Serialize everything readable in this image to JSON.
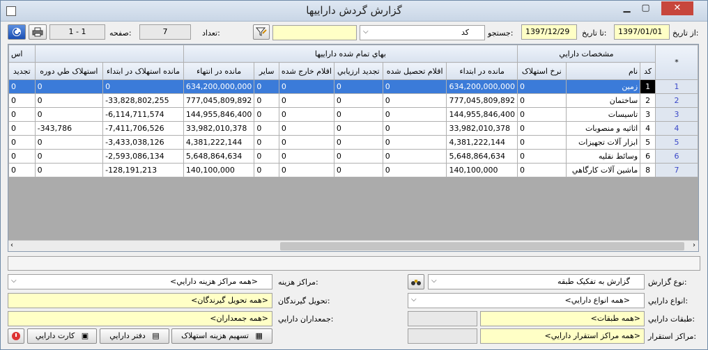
{
  "window": {
    "title": "گزارش گردش داراییها"
  },
  "toolbar": {
    "from_date_label": "از تاریخ:",
    "from_date": "1397/01/01",
    "to_date_label": "تا تاریخ:",
    "to_date": "1397/12/29",
    "search_label": "جستجو:",
    "search_field": "کد",
    "search_value": "",
    "count_label": "تعداد:",
    "count_value": "7",
    "page_label": "صفحه:",
    "page_value": "1 - 1"
  },
  "grid": {
    "groups": {
      "asset_specs": "مشخصات دارايي",
      "total_cost": "بهاي تمام شده داراییها",
      "partial": "اس"
    },
    "columns": {
      "star": "*",
      "code": "کد",
      "name": "نام",
      "dep_rate": "نرخ استهلاک",
      "opening_balance": "مانده در ابتداء",
      "additions": "اقلام تحصيل شده",
      "revaluation": "تجديد ارزيابي",
      "disposals": "اقلام خارج شده",
      "other": "ساير",
      "closing_balance": "مانده در انتهاء",
      "opening_accum_dep": "مانده استهلاک در ابتداء",
      "period_dep": "استهلاک طي دوره",
      "renew": "تجديد"
    },
    "rows": [
      {
        "rn": "1",
        "code": "1",
        "name": "زمين",
        "dep_rate": "0",
        "opening_balance": "634,200,000,000",
        "additions": "0",
        "revaluation": "0",
        "disposals": "0",
        "other": "0",
        "closing_balance": "634,200,000,000",
        "opening_accum_dep": "0",
        "period_dep": "0",
        "renew": "0"
      },
      {
        "rn": "2",
        "code": "2",
        "name": "ساختمان",
        "dep_rate": "0",
        "opening_balance": "777,045,809,892",
        "additions": "0",
        "revaluation": "0",
        "disposals": "0",
        "other": "0",
        "closing_balance": "777,045,809,892",
        "opening_accum_dep": "-33,828,802,255",
        "period_dep": "0",
        "renew": "0"
      },
      {
        "rn": "3",
        "code": "3",
        "name": "تاسيسات",
        "dep_rate": "0",
        "opening_balance": "144,955,846,400",
        "additions": "0",
        "revaluation": "0",
        "disposals": "0",
        "other": "0",
        "closing_balance": "144,955,846,400",
        "opening_accum_dep": "-6,114,711,574",
        "period_dep": "0",
        "renew": "0"
      },
      {
        "rn": "4",
        "code": "4",
        "name": "اثاثيه و منصوبات",
        "dep_rate": "0",
        "opening_balance": "33,982,010,378",
        "additions": "0",
        "revaluation": "0",
        "disposals": "0",
        "other": "0",
        "closing_balance": "33,982,010,378",
        "opening_accum_dep": "-7,411,706,526",
        "period_dep": "-343,786",
        "renew": "0"
      },
      {
        "rn": "5",
        "code": "5",
        "name": "ابزار آلات تجهيزات",
        "dep_rate": "0",
        "opening_balance": "4,381,222,144",
        "additions": "0",
        "revaluation": "0",
        "disposals": "0",
        "other": "0",
        "closing_balance": "4,381,222,144",
        "opening_accum_dep": "-3,433,038,126",
        "period_dep": "0",
        "renew": "0"
      },
      {
        "rn": "6",
        "code": "6",
        "name": "وسائط نقليه",
        "dep_rate": "0",
        "opening_balance": "5,648,864,634",
        "additions": "0",
        "revaluation": "0",
        "disposals": "0",
        "other": "0",
        "closing_balance": "5,648,864,634",
        "opening_accum_dep": "-2,593,086,134",
        "period_dep": "0",
        "renew": "0"
      },
      {
        "rn": "7",
        "code": "8",
        "name": "ماشين آلات کارگاهي",
        "dep_rate": "0",
        "opening_balance": "140,100,000",
        "additions": "0",
        "revaluation": "0",
        "disposals": "0",
        "other": "0",
        "closing_balance": "140,100,000",
        "opening_accum_dep": "-128,191,213",
        "period_dep": "0",
        "renew": "0"
      }
    ]
  },
  "filters": {
    "report_type_label": "نوع گزارش:",
    "report_type": "گزارش به تفکيک طبقه",
    "cost_centers_label": "مراکز هزينه:",
    "cost_centers": "<همه مراکز هزينه دارايي>",
    "asset_types_label": "انواع دارايي:",
    "asset_types": "<همه انواع دارايي>",
    "receivers_label": "تحويل گيرندگان:",
    "receivers": "<همه تحويل گيرندگان>",
    "classes_label": "طبقات دارايي:",
    "classes": "<همه طبقات>",
    "collectors_label": "جمعداران دارايي:",
    "collectors": "<همه جمعداران>",
    "locations_label": "مراکز استقرار:",
    "locations": "<همه مراکز استقرار دارايي>"
  },
  "buttons": {
    "allocate_dep": "تسهيم هزينه استهلاک",
    "asset_ledger": "دفتر دارايي",
    "asset_card": "کارت دارايي"
  }
}
